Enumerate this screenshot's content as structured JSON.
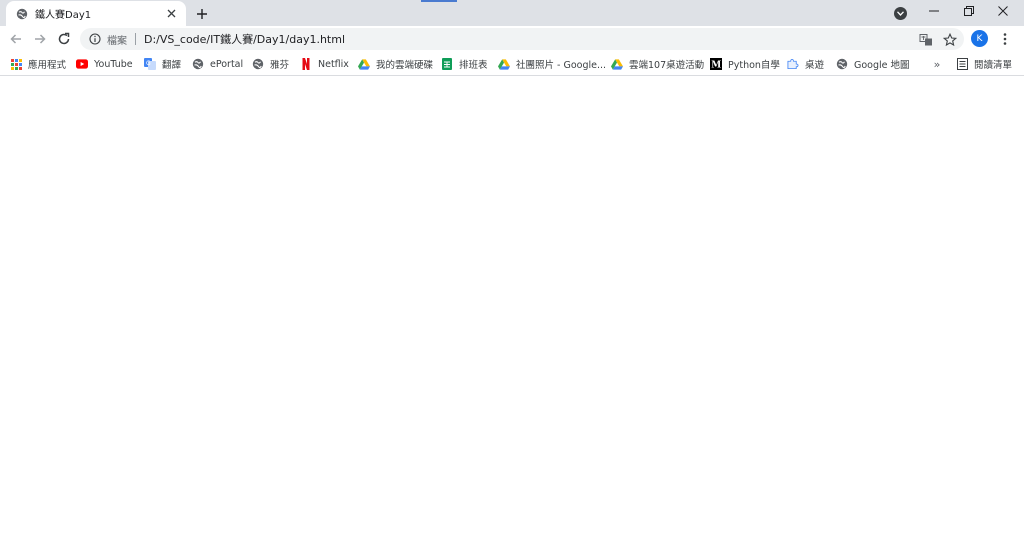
{
  "tab": {
    "title": "鐵人賽Day1"
  },
  "toolbar": {
    "scheme_label": "檔案",
    "url": "D:/VS_code/IT鐵人賽/Day1/day1.html",
    "profile_initial": "K"
  },
  "bookmarks": [
    {
      "label": "應用程式",
      "icon": "apps-grid-icon"
    },
    {
      "label": "YouTube",
      "icon": "youtube-icon"
    },
    {
      "label": "翻譯",
      "icon": "translate-icon"
    },
    {
      "label": "ePortal",
      "icon": "globe-icon"
    },
    {
      "label": "雅芬",
      "icon": "globe-icon"
    },
    {
      "label": "Netflix",
      "icon": "netflix-icon"
    },
    {
      "label": "我的雲端硬碟",
      "icon": "drive-icon"
    },
    {
      "label": "排班表",
      "icon": "sheets-icon"
    },
    {
      "label": "社團照片 - Google...",
      "icon": "drive-icon"
    },
    {
      "label": "雲端107桌遊活動",
      "icon": "drive-icon"
    },
    {
      "label": "Python自學",
      "icon": "medium-icon"
    },
    {
      "label": "桌遊",
      "icon": "puzzle-icon"
    },
    {
      "label": "Google 地圖",
      "icon": "globe-icon"
    }
  ],
  "bookmarks_more": "»",
  "reading_list": "閱讀清單",
  "colors": {
    "tabstrip": "#dee1e6",
    "omnibox": "#f1f3f4",
    "youtube": "#ff0000",
    "netflix": "#e50914",
    "sheets": "#0f9d58",
    "profile": "#1a73e8"
  }
}
